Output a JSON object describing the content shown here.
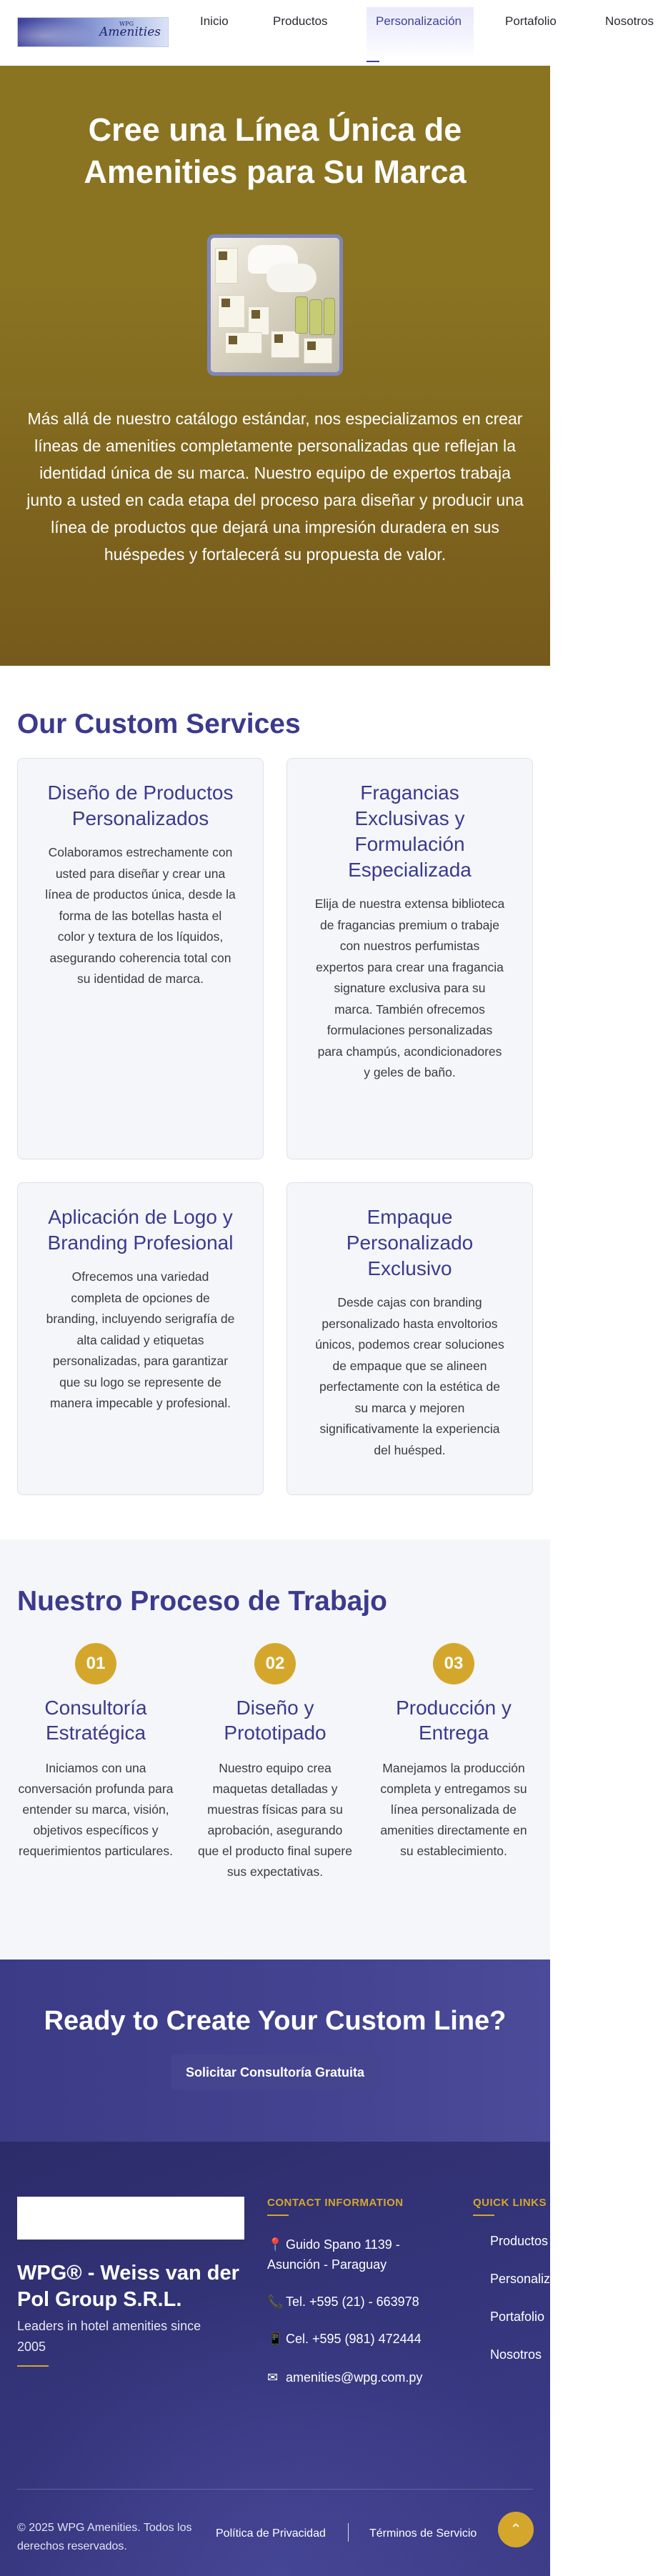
{
  "nav": {
    "logo_text": "Amenities",
    "logo_sub": "WPG",
    "items": [
      {
        "label": "Inicio"
      },
      {
        "label": "Productos"
      },
      {
        "label": "Personalización"
      },
      {
        "label": "Portafolio"
      },
      {
        "label": "Nosotros"
      }
    ],
    "active_item": "Personalización"
  },
  "hero": {
    "title": "Cree una Línea Única de Amenities para Su Marca",
    "description": "Más allá de nuestro catálogo estándar, nos especializamos en crear líneas de amenities completamente personalizadas que reflejan la identidad única de su marca. Nuestro equipo de expertos trabaja junto a usted en cada etapa del proceso para diseñar y producir una línea de productos que dejará una impresión duradera en sus huéspedes y fortalecerá su propuesta de valor."
  },
  "services": {
    "title": "Our Custom Services",
    "cards": [
      {
        "title": "Diseño de Productos Personalizados",
        "description": "Colaboramos estrechamente con usted para diseñar y crear una línea de productos única, desde la forma de las botellas hasta el color y textura de los líquidos, asegurando coherencia total con su identidad de marca."
      },
      {
        "title": "Fragancias Exclusivas y Formulación Especializada",
        "description": "Elija de nuestra extensa biblioteca de fragancias premium o trabaje con nuestros perfumistas expertos para crear una fragancia signature exclusiva para su marca. También ofrecemos formulaciones personalizadas para champús, acondicionadores y geles de baño."
      },
      {
        "title": "Aplicación de Logo y Branding Profesional",
        "description": "Ofrecemos una variedad completa de opciones de branding, incluyendo serigrafía de alta calidad y etiquetas personalizadas, para garantizar que su logo se represente de manera impecable y profesional."
      },
      {
        "title": "Empaque Personalizado Exclusivo",
        "description": "Desde cajas con branding personalizado hasta envoltorios únicos, podemos crear soluciones de empaque que se alineen perfectamente con la estética de su marca y mejoren significativamente la experiencia del huésped."
      }
    ]
  },
  "process": {
    "title": "Nuestro Proceso de Trabajo",
    "steps": [
      {
        "number": "01",
        "title": "Consultoría Estratégica",
        "description": "Iniciamos con una conversación profunda para entender su marca, visión, objetivos específicos y requerimientos particulares."
      },
      {
        "number": "02",
        "title": "Diseño y Prototipado",
        "description": "Nuestro equipo crea maquetas detalladas y muestras físicas para su aprobación, asegurando que el producto final supere sus expectativas."
      },
      {
        "number": "03",
        "title": "Producción y Entrega",
        "description": "Manejamos la producción completa y entregamos su línea personalizada de amenities directamente en su establecimiento."
      }
    ]
  },
  "cta": {
    "title": "Ready to Create Your Custom Line?",
    "button_label": "Solicitar Consultoría Gratuita"
  },
  "footer": {
    "company": "WPG® - Weiss van der Pol Group S.R.L.",
    "tagline": "Leaders in hotel amenities since 2005",
    "contact_heading": "CONTACT INFORMATION",
    "contact": {
      "address_icon": "📍",
      "address": "Guido Spano 1139 - Asunción - Paraguay",
      "phone_icon": "📞",
      "phone": "Tel. +595 (21) - 663978",
      "mobile_icon": "📱",
      "mobile": "Cel. +595 (981) 472444",
      "email_icon": "✉",
      "email": "amenities@wpg.com.py"
    },
    "links_heading": "QUICK LINKS",
    "links": [
      {
        "label": "Productos"
      },
      {
        "label": "Personalización"
      },
      {
        "label": "Portafolio"
      },
      {
        "label": "Nosotros"
      }
    ],
    "copyright": "© 2025 WPG Amenities. Todos los derechos reservados.",
    "privacy_label": "Política de Privacidad",
    "terms_label": "Términos de Servicio",
    "back_to_top_icon": "⌃"
  },
  "colors": {
    "brand_purple": "#3b3a8e",
    "gold": "#d4a72c",
    "hero_bg": "#8a7422",
    "card_bg": "#f5f6fa"
  }
}
